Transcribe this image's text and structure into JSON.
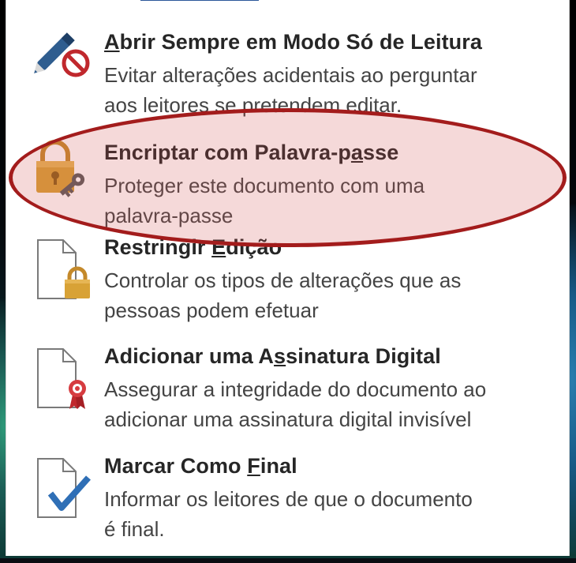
{
  "menu": {
    "items": [
      {
        "id": "read-only",
        "title_pre": "",
        "title_key": "A",
        "title_post": "brir Sempre em Modo Só de Leitura",
        "desc_line1": "Evitar alterações acidentais ao perguntar",
        "desc_line2": "aos leitores se pretendem editar.",
        "icon": "pen-prohibited-icon"
      },
      {
        "id": "encrypt",
        "title_pre": "Encriptar com Palavra-p",
        "title_key": "a",
        "title_post": "sse",
        "desc_line1": "Proteger este documento com uma",
        "desc_line2": "palavra-passe",
        "icon": "lock-key-icon"
      },
      {
        "id": "restrict",
        "title_pre": "Restringir ",
        "title_key": "E",
        "title_post": "dição",
        "desc_line1": "Controlar os tipos de alterações que as",
        "desc_line2": "pessoas podem efetuar",
        "icon": "document-lock-icon"
      },
      {
        "id": "signature",
        "title_pre": "Adicionar uma A",
        "title_key": "s",
        "title_post": "sinatura Digital",
        "desc_line1": "Assegurar a integridade do documento ao",
        "desc_line2": "adicionar uma assinatura digital invisível",
        "icon": "document-ribbon-icon"
      },
      {
        "id": "final",
        "title_pre": "Marcar Como ",
        "title_key": "F",
        "title_post": "inal",
        "desc_line1": "Informar os leitores de que o documento",
        "desc_line2": "é final.",
        "icon": "document-check-icon"
      }
    ]
  },
  "colors": {
    "accent": "#2b579a",
    "highlight_border": "#a31c1c",
    "highlight_fill": "#d25050",
    "lock_gold": "#d8a236"
  }
}
